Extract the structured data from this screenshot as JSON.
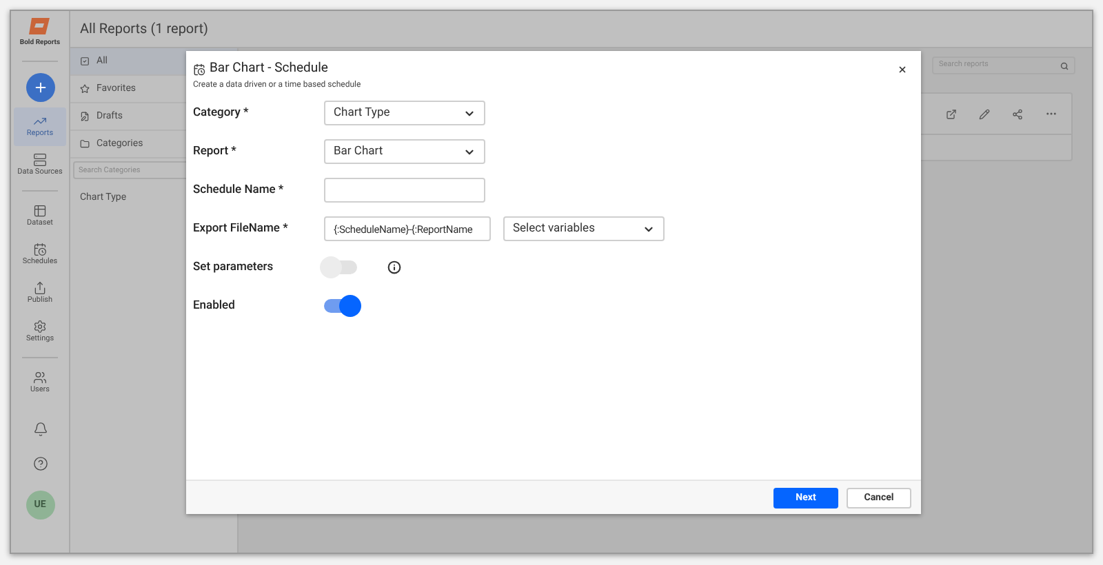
{
  "app": {
    "logo_text": "Bold Reports",
    "page_title": "All Reports (1 report)",
    "avatar": "UE"
  },
  "nav": [
    {
      "label": "Reports",
      "selected": true
    },
    {
      "label": "Data Sources",
      "selected": false
    },
    {
      "label": "Dataset",
      "selected": false
    },
    {
      "label": "Schedules",
      "selected": false
    },
    {
      "label": "Publish",
      "selected": false
    },
    {
      "label": "Settings",
      "selected": false
    },
    {
      "label": "Users",
      "selected": false
    }
  ],
  "filters": [
    {
      "label": "All",
      "selected": true
    },
    {
      "label": "Favorites",
      "selected": false
    },
    {
      "label": "Drafts",
      "selected": false
    },
    {
      "label": "Categories",
      "selected": false
    }
  ],
  "category_search": {
    "placeholder": "Search Categories"
  },
  "categories": [
    "Chart Type"
  ],
  "report_search": {
    "placeholder": "Search reports"
  },
  "dialog": {
    "title": "Bar Chart - Schedule",
    "subtitle": "Create a data driven or a time based schedule",
    "fields": [
      {
        "label": "Category *",
        "kind": "select",
        "value": "Chart Type"
      },
      {
        "label": "Report *",
        "kind": "select",
        "value": "Bar Chart"
      },
      {
        "label": "Schedule Name *",
        "kind": "text"
      },
      {
        "label": "Export FileName *",
        "kind": "text_select",
        "value": "{:ScheduleName}-{:ReportName",
        "select_value": "Select variables"
      },
      {
        "label": "Set parameters",
        "kind": "toggle",
        "on": false,
        "has_info": true
      },
      {
        "label": "Enabled",
        "kind": "toggle",
        "on": true,
        "has_info": false
      }
    ],
    "buttons": [
      {
        "label": "Next",
        "kind": "primary"
      },
      {
        "label": "Cancel",
        "kind": "secondary"
      }
    ]
  }
}
